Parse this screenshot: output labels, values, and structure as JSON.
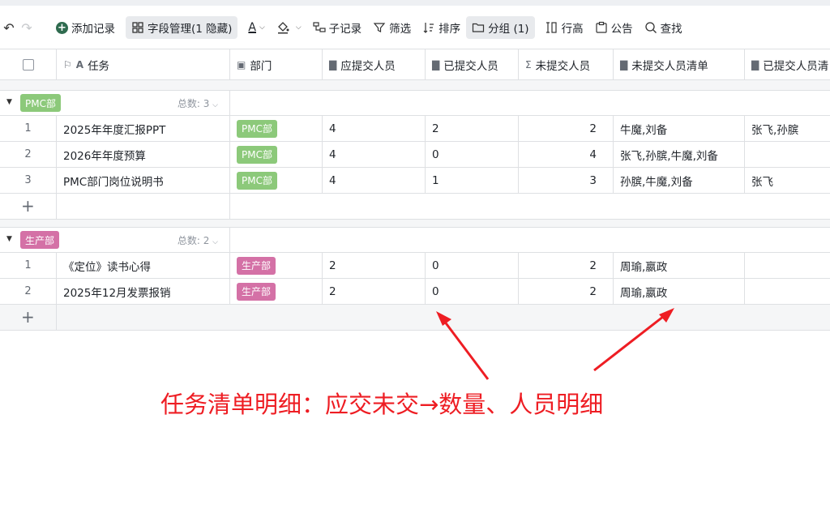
{
  "toolbar": {
    "add_record": "添加记录",
    "field_manage": "字段管理(1 隐藏)",
    "text_style": "A",
    "sub_record": "子记录",
    "filter": "筛选",
    "sort": "排序",
    "group": "分组 (1)",
    "row_height": "行高",
    "notice": "公告",
    "search": "查找"
  },
  "columns": [
    "任务",
    "部门",
    "应提交人员",
    "已提交人员",
    "未提交人员",
    "未提交人员清单",
    "已提交人员清"
  ],
  "groups": [
    {
      "name": "PMC部",
      "color": "#8cc97a",
      "count_label": "总数: 3",
      "rows": [
        {
          "idx": "1",
          "task": "2025年年度汇报PPT",
          "dept": "PMC部",
          "should": "4",
          "done": "2",
          "undone": "2",
          "undone_list": "牛魔,刘备",
          "done_list": "张飞,孙膑"
        },
        {
          "idx": "2",
          "task": "2026年年度预算",
          "dept": "PMC部",
          "should": "4",
          "done": "0",
          "undone": "4",
          "undone_list": "张飞,孙膑,牛魔,刘备",
          "done_list": ""
        },
        {
          "idx": "3",
          "task": "PMC部门岗位说明书",
          "dept": "PMC部",
          "should": "4",
          "done": "1",
          "undone": "3",
          "undone_list": "孙膑,牛魔,刘备",
          "done_list": "张飞"
        }
      ]
    },
    {
      "name": "生产部",
      "color": "#d471a6",
      "count_label": "总数: 2",
      "rows": [
        {
          "idx": "1",
          "task": "《定位》读书心得",
          "dept": "生产部",
          "should": "2",
          "done": "0",
          "undone": "2",
          "undone_list": "周瑜,嬴政",
          "done_list": ""
        },
        {
          "idx": "2",
          "task": "2025年12月发票报销",
          "dept": "生产部",
          "should": "2",
          "done": "0",
          "undone": "2",
          "undone_list": "周瑜,嬴政",
          "done_list": ""
        }
      ]
    }
  ],
  "annotation": "任务清单明细：应交未交→数量、人员明细",
  "colors": {
    "annotation": "#ee1d23",
    "pmc_tag": "#8cc97a",
    "prod_tag": "#d471a6"
  }
}
